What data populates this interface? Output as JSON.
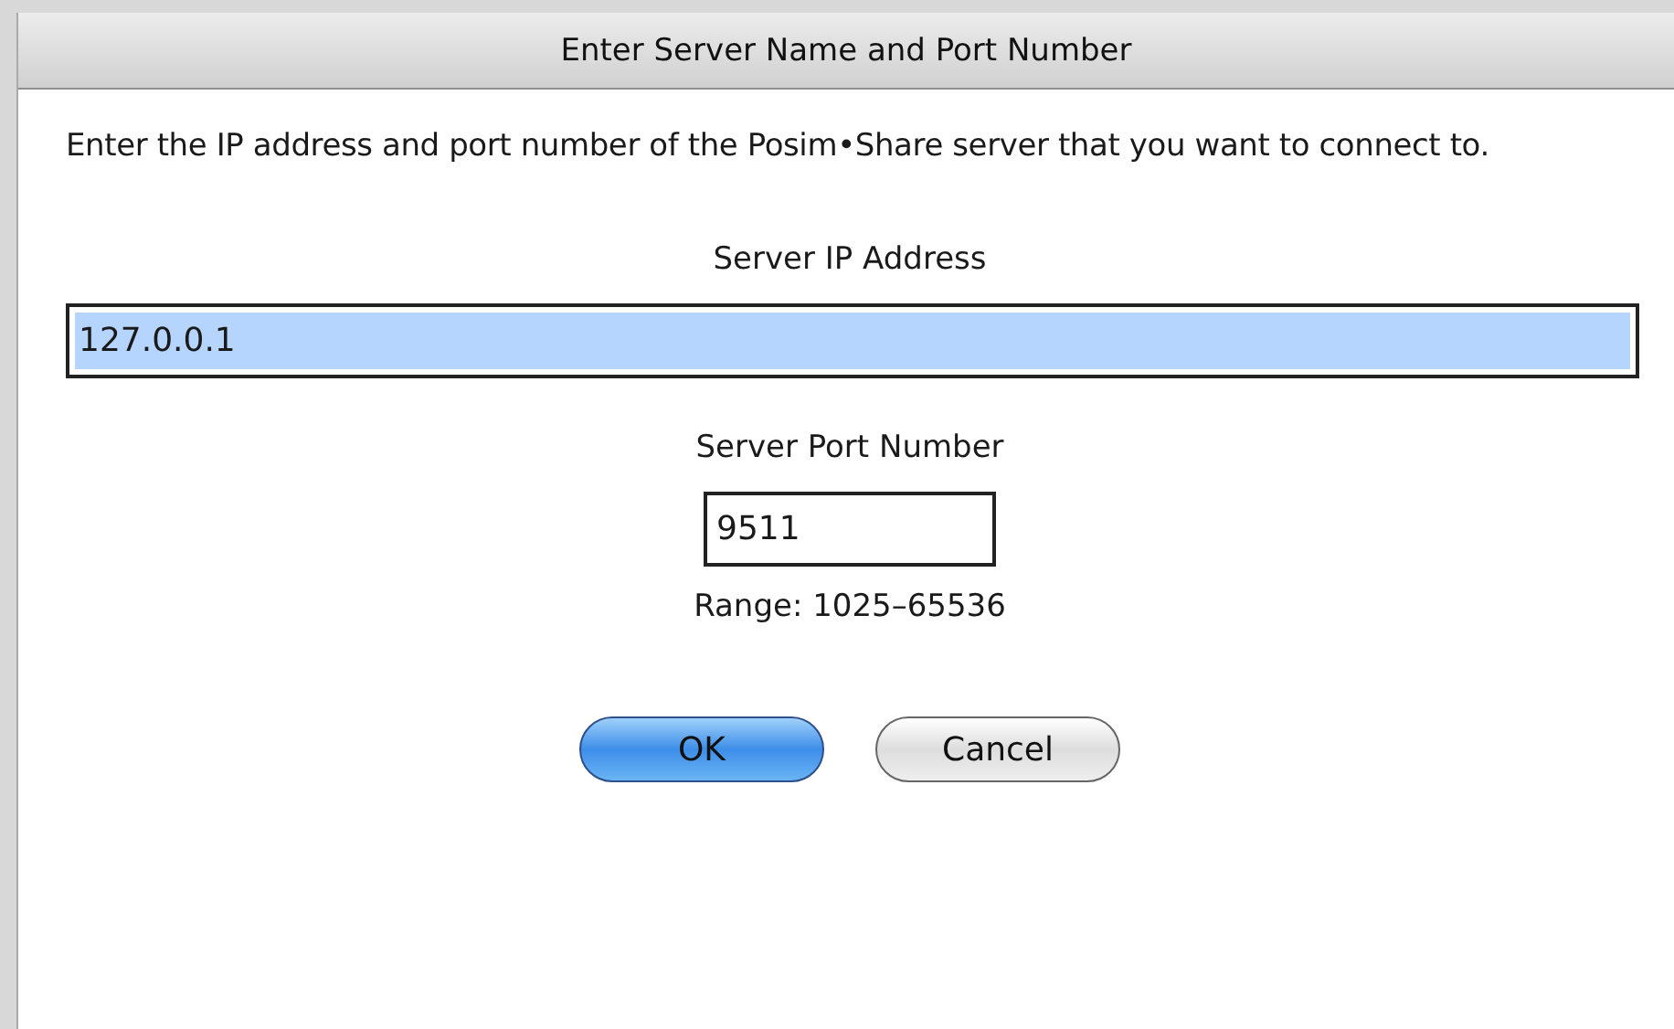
{
  "window": {
    "title": "Enter Server Name and Port Number"
  },
  "message": "Enter the IP address and port number of the Posim•Share server that you want to connect to.",
  "fields": [
    {
      "label": "Server IP Address",
      "value": "127.0.0.1",
      "selected": true,
      "kind": "wide"
    },
    {
      "label": "Server Port Number",
      "value": "9511",
      "selected": false,
      "kind": "short"
    }
  ],
  "range_hint": "Range: 1025–65536",
  "buttons": [
    {
      "label": "OK",
      "default": true
    },
    {
      "label": "Cancel",
      "default": false
    }
  ]
}
